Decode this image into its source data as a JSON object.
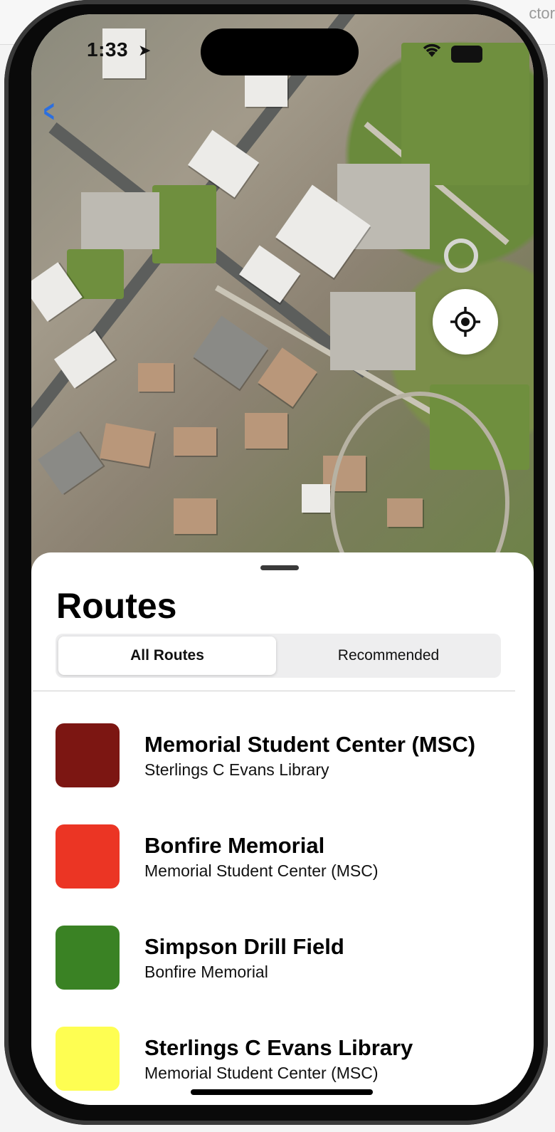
{
  "status_bar": {
    "time": "1:33",
    "location_icon": "location-arrow-icon",
    "wifi_icon": "wifi-icon",
    "battery_icon": "battery-icon"
  },
  "desktop": {
    "right_text": "ctor"
  },
  "nav": {
    "back_icon": "chevron-left-icon"
  },
  "map": {
    "locate_icon": "crosshair-icon"
  },
  "sheet": {
    "title": "Routes",
    "tabs": [
      {
        "label": "All Routes",
        "selected": true
      },
      {
        "label": "Recommended",
        "selected": false
      }
    ],
    "routes": [
      {
        "title": "Memorial Student Center (MSC)",
        "subtitle": "Sterlings C Evans Library",
        "color": "#7c1612"
      },
      {
        "title": "Bonfire Memorial",
        "subtitle": "Memorial Student Center (MSC)",
        "color": "#eb3524"
      },
      {
        "title": "Simpson Drill Field",
        "subtitle": "Bonfire Memorial",
        "color": "#3a8224"
      },
      {
        "title": "Sterlings C Evans Library",
        "subtitle": "Memorial Student Center (MSC)",
        "color": "#fefe52"
      }
    ]
  }
}
